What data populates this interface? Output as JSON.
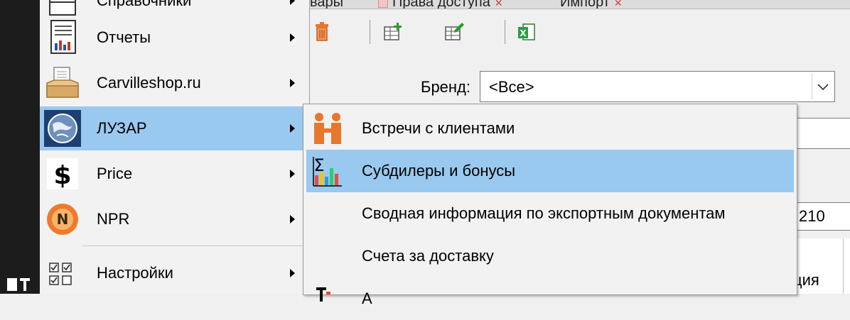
{
  "window": {
    "tabs": [
      {
        "label": "вары"
      },
      {
        "label": "Права доступа"
      },
      {
        "label": "Импорт"
      }
    ]
  },
  "toolbar": {
    "icons": [
      "delete-icon",
      "add-row-icon",
      "edit-row-icon",
      "excel-export-icon"
    ]
  },
  "filters": {
    "brand_label": "Бренд:",
    "brand_value": "<Все>",
    "field3_value": "210",
    "grid_header_fragment": "ция"
  },
  "main_menu": {
    "items": [
      {
        "label": "Справочники",
        "icon": "directory-icon"
      },
      {
        "label": "Отчеты",
        "icon": "reports-icon"
      },
      {
        "label": "Carvilleshop.ru",
        "icon": "shop-icon"
      },
      {
        "label": "ЛУЗАР",
        "icon": "globe-icon"
      },
      {
        "label": "Price",
        "icon": "dollar-icon"
      },
      {
        "label": "NPR",
        "icon": "npr-icon"
      },
      {
        "label": "Настройки",
        "icon": "settings-checklist-icon"
      }
    ]
  },
  "sub_menu": {
    "items": [
      {
        "label": "Встречи с клиентами",
        "icon": "meeting-icon"
      },
      {
        "label": "Субдилеры и бонусы",
        "icon": "sigma-chart-icon"
      },
      {
        "label": "Сводная информация по экспортным документам",
        "icon": ""
      },
      {
        "label": "Счета за доставку",
        "icon": ""
      },
      {
        "label": "А",
        "icon": "text-tool-icon"
      }
    ]
  },
  "colors": {
    "highlight": "#99c9ef",
    "menu_bg": "#f2f2f2",
    "left_strip": "#1c1c1c",
    "accent_orange": "#e8772e"
  }
}
